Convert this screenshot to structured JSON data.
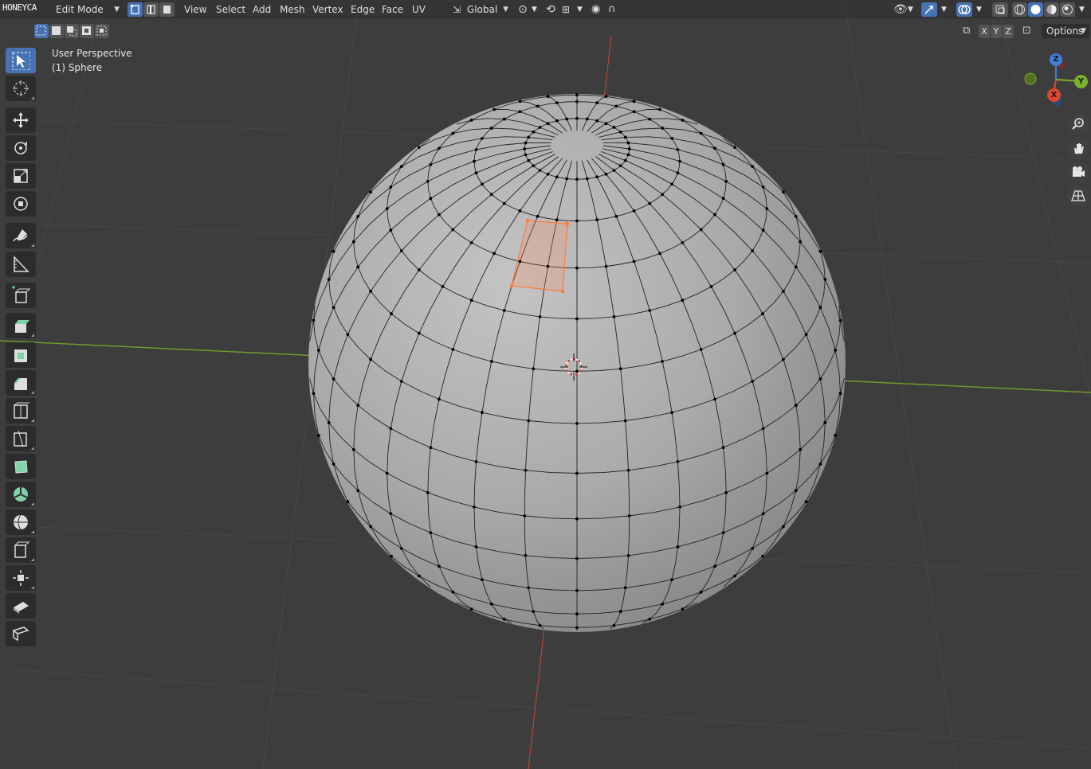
{
  "watermark": "HONEYCAM.ORG",
  "header": {
    "mode_label": "Edit Mode",
    "menus": [
      "View",
      "Select",
      "Add",
      "Mesh",
      "Vertex",
      "Edge",
      "Face",
      "UV"
    ],
    "transform_orientation": "Global",
    "options_label": "Options",
    "axis_toggles": [
      "X",
      "Y",
      "Z"
    ]
  },
  "overlay": {
    "view_name": "User Perspective",
    "object_name": "(1) Sphere"
  },
  "gizmo": {
    "x": "X",
    "y": "Y",
    "z": "Z"
  },
  "colors": {
    "background": "#3d3d3d",
    "accent": "#4772b3",
    "selection": "#ff7a3c",
    "axis_x": "#e0452f",
    "axis_y": "#7ab32a",
    "axis_z": "#3f7fd6"
  },
  "toolbar": {
    "tools": [
      "select-box",
      "cursor",
      "move",
      "rotate",
      "scale",
      "transform",
      "annotate",
      "measure",
      "add-cube",
      "extrude-region",
      "inset-faces",
      "bevel",
      "loop-cut",
      "knife",
      "poly-build",
      "spin",
      "smooth",
      "edge-slide",
      "shrink-fatten",
      "shear",
      "rip-region"
    ]
  }
}
